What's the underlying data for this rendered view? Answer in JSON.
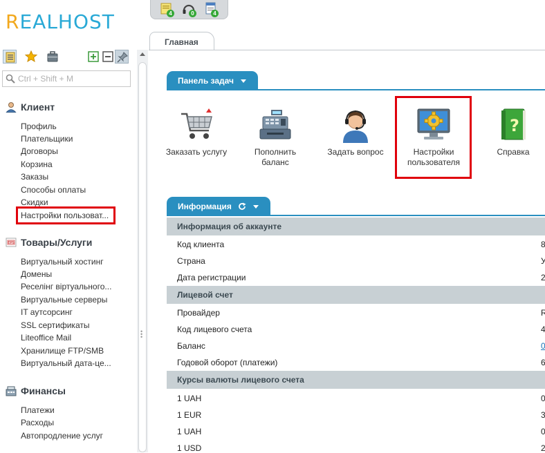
{
  "logo": {
    "text_r": "R",
    "text_rest": "EALHOST"
  },
  "top_tools": [
    {
      "icon": "notes-icon",
      "badge": "4"
    },
    {
      "icon": "headset-icon",
      "badge": "0"
    },
    {
      "icon": "document-icon",
      "badge": "4"
    }
  ],
  "sidebar": {
    "search_placeholder": "Ctrl + Shift + M",
    "sections": [
      {
        "title": "Клиент",
        "icon": "client-icon",
        "items": [
          "Профиль",
          "Плательщики",
          "Договоры",
          "Корзина",
          "Заказы",
          "Способы оплаты",
          "Скидки",
          "Настройки пользоват..."
        ]
      },
      {
        "title": "Товары/Услуги",
        "icon": "products-icon",
        "items": [
          "Виртуальный хостинг",
          "Домены",
          "Реселінг віртуального...",
          "Виртуальные серверы",
          "IT аутсорсинг",
          "SSL сертификаты",
          "Liteoffice Mail",
          "Хранилище FTP/SMB",
          "Виртуальный дата-це..."
        ]
      },
      {
        "title": "Финансы",
        "icon": "finance-icon",
        "items": [
          "Платежи",
          "Расходы",
          "Автопродление услуг"
        ]
      }
    ]
  },
  "main": {
    "tab": "Главная",
    "task_panel": {
      "title": "Панель задач",
      "tasks": [
        {
          "label": "Заказать услугу",
          "icon": "cart-icon"
        },
        {
          "label": "Пополнить\nбаланс",
          "icon": "cash-register-icon"
        },
        {
          "label": "Задать вопрос",
          "icon": "support-agent-icon"
        },
        {
          "label": "Настройки\nпользователя",
          "icon": "settings-monitor-icon"
        },
        {
          "label": "Справка",
          "icon": "help-book-icon"
        }
      ]
    },
    "info_panel": {
      "title": "Информация",
      "groups": [
        {
          "title": "Информация об аккаунте",
          "rows": [
            {
              "key": "Код клиента",
              "value": "8"
            },
            {
              "key": "Страна",
              "value": "У"
            },
            {
              "key": "Дата регистрации",
              "value": "2"
            }
          ]
        },
        {
          "title": "Лицевой счет",
          "rows": [
            {
              "key": "Провайдер",
              "value": "R"
            },
            {
              "key": "Код лицевого счета",
              "value": "4"
            },
            {
              "key": "Баланс",
              "value": "0"
            },
            {
              "key": "Годовой оборот (платежи)",
              "value": "6"
            }
          ]
        },
        {
          "title": "Курсы валюты лицевого счета",
          "rows": [
            {
              "key": "1 UAH",
              "value": "0"
            },
            {
              "key": "1 EUR",
              "value": "3"
            },
            {
              "key": "1 UAH",
              "value": "0"
            },
            {
              "key": "1 USD",
              "value": "2"
            }
          ]
        }
      ]
    }
  },
  "colors": {
    "accent": "#2a8fc0",
    "highlight": "#e0000b",
    "group_bg": "#c8d0d4",
    "logo_blue": "#29a9d6",
    "logo_orange": "#f2a81d"
  }
}
